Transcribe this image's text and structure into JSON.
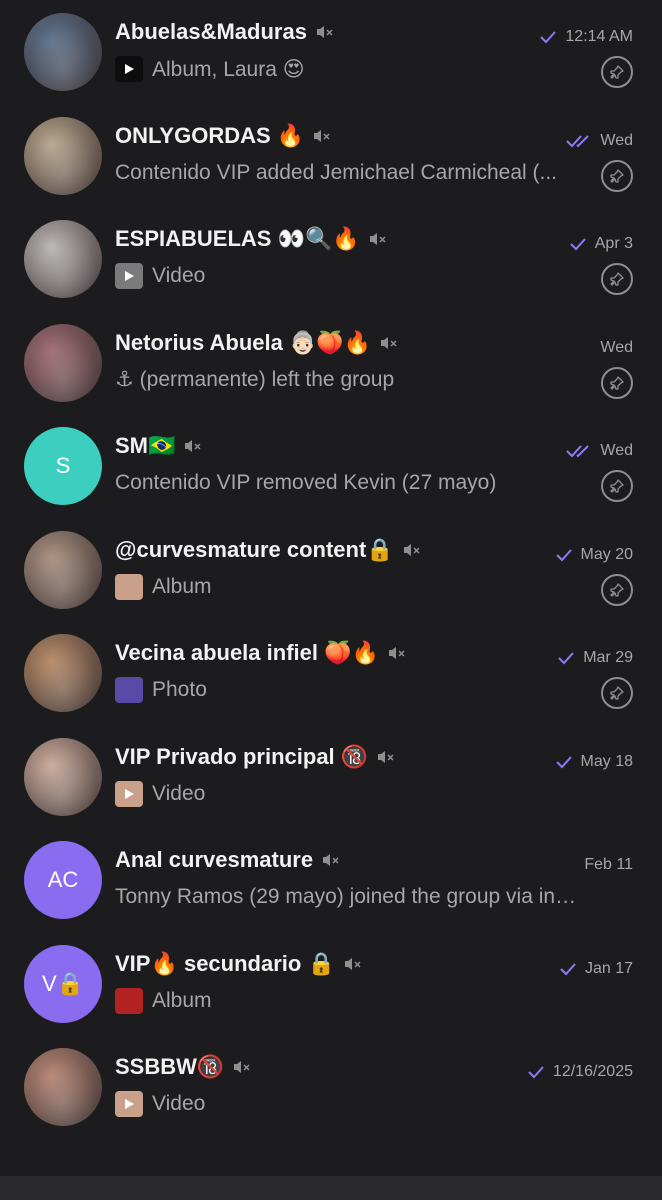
{
  "chats": [
    {
      "title": "Abuelas&Maduras",
      "emoji": "",
      "muted": true,
      "time": "12:14 AM",
      "check": "single",
      "sub_prefix": "",
      "sub": "Album, Laura 😍",
      "thumb": "play-black",
      "pinned": true,
      "avatar": {
        "type": "photo",
        "color": "#5b6f8a"
      }
    },
    {
      "title": "ONLYGORDAS 🔥",
      "emoji": "",
      "muted": true,
      "time": "Wed",
      "check": "double",
      "sub_prefix": "",
      "sub": "Contenido VIP added Jemichael Carmicheal (...",
      "thumb": "",
      "pinned": true,
      "avatar": {
        "type": "photo",
        "color": "#b7a48b"
      }
    },
    {
      "title": "ESPIABUELAS 👀🔍🔥",
      "emoji": "",
      "muted": true,
      "time": "Apr 3",
      "check": "single",
      "sub_prefix": "",
      "sub": "Video",
      "thumb": "video-gray",
      "pinned": true,
      "avatar": {
        "type": "photo",
        "color": "#b8b5b3"
      }
    },
    {
      "title": "Netorius Abuela 👵🏻🍑🔥",
      "emoji": "",
      "muted": true,
      "time": "Wed",
      "check": "none",
      "sub_prefix": "⚓ ",
      "sub": "(permanente) left the group",
      "thumb": "",
      "pinned": true,
      "avatar": {
        "type": "photo",
        "color": "#9e6a74"
      }
    },
    {
      "title": "SM🇧🇷",
      "emoji": "",
      "muted": true,
      "time": "Wed",
      "check": "double",
      "sub_prefix": "",
      "sub": "Contenido VIP removed Kevin (27 mayo)",
      "thumb": "",
      "pinned": true,
      "avatar": {
        "type": "letter",
        "letter": "S",
        "color": "#3ccfc0"
      }
    },
    {
      "title": "@curvesmature content🔒",
      "emoji": "",
      "muted": true,
      "time": "May 20",
      "check": "single",
      "sub_prefix": "",
      "sub": "Album",
      "thumb": "photo-skin",
      "pinned": true,
      "avatar": {
        "type": "photo",
        "color": "#a88e7e"
      }
    },
    {
      "title": "Vecina abuela infiel 🍑🔥",
      "emoji": "",
      "muted": true,
      "time": "Mar 29",
      "check": "single",
      "sub_prefix": "",
      "sub": "Photo",
      "thumb": "photo-purple",
      "pinned": true,
      "avatar": {
        "type": "photo",
        "color": "#b58967"
      }
    },
    {
      "title": "VIP Privado principal 🔞",
      "emoji": "",
      "muted": true,
      "time": "May 18",
      "check": "single",
      "sub_prefix": "",
      "sub": "Video",
      "thumb": "video-skin",
      "pinned": false,
      "avatar": {
        "type": "photo",
        "color": "#c9a99a"
      }
    },
    {
      "title": "Anal curvesmature",
      "emoji": "",
      "muted": true,
      "time": "Feb 11",
      "check": "none",
      "sub_prefix": "",
      "sub": "Tonny Ramos (29 mayo) joined the group via invit...",
      "thumb": "",
      "pinned": false,
      "avatar": {
        "type": "letter",
        "letter": "AC",
        "color": "#8a6cf0"
      }
    },
    {
      "title": "VIP🔥 secundario 🔒",
      "emoji": "",
      "muted": true,
      "time": "Jan 17",
      "check": "single",
      "sub_prefix": "",
      "sub": "Album",
      "thumb": "photo-red",
      "pinned": false,
      "avatar": {
        "type": "letter",
        "letter": "V🔒",
        "color": "#8a6cf0"
      }
    },
    {
      "title": "SSBBW🔞",
      "emoji": "",
      "muted": true,
      "time": "12/16/2025",
      "check": "single",
      "sub_prefix": "",
      "sub": "Video",
      "thumb": "video-skin",
      "pinned": false,
      "avatar": {
        "type": "photo",
        "color": "#b48472"
      }
    }
  ],
  "colors": {
    "background": "#1c1c1e",
    "title": "#f2f2f2",
    "secondary": "#a6a6ab",
    "check": "#8b7cf6",
    "pin_border": "#8e8e93"
  },
  "icons": {
    "mute": "muted-speaker-icon",
    "check": "read-check-icon",
    "pin": "pin-icon"
  }
}
